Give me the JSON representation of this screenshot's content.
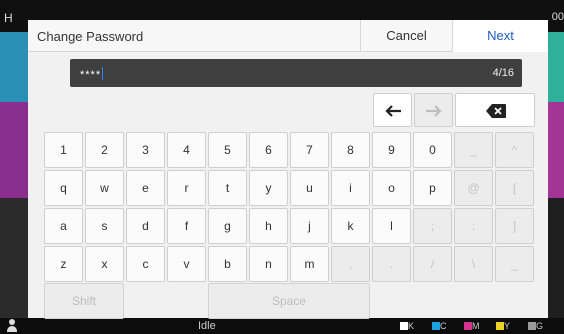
{
  "background": {
    "top_left_text": "H",
    "top_right_text": "00",
    "status": "Idle",
    "toner": [
      {
        "label": "K",
        "color": "#ffffff"
      },
      {
        "label": "C",
        "color": "#1aa3e0"
      },
      {
        "label": "M",
        "color": "#d6338f"
      },
      {
        "label": "Y",
        "color": "#f0d12a"
      },
      {
        "label": "G",
        "color": "#9a9a9a"
      }
    ],
    "tile_colors": [
      "#2a8fb5",
      "#2fb09a",
      "#8a2e8f",
      "#a23596",
      "#2b2b2b"
    ]
  },
  "dialog": {
    "title": "Change Password",
    "cancel_label": "Cancel",
    "next_label": "Next",
    "accent": "#1e5cc7"
  },
  "password": {
    "masked_value": "****",
    "count": "4/16"
  },
  "cursor_keys": {
    "left": {
      "icon": "arrow-left-icon",
      "enabled": true
    },
    "right": {
      "icon": "arrow-right-icon",
      "enabled": false
    },
    "backspace": {
      "icon": "backspace-icon",
      "enabled": true
    }
  },
  "keyboard": {
    "rows": [
      [
        {
          "label": "1",
          "enabled": true
        },
        {
          "label": "2",
          "enabled": true
        },
        {
          "label": "3",
          "enabled": true
        },
        {
          "label": "4",
          "enabled": true
        },
        {
          "label": "5",
          "enabled": true
        },
        {
          "label": "6",
          "enabled": true
        },
        {
          "label": "7",
          "enabled": true
        },
        {
          "label": "8",
          "enabled": true
        },
        {
          "label": "9",
          "enabled": true
        },
        {
          "label": "0",
          "enabled": true
        },
        {
          "label": "_",
          "enabled": false
        },
        {
          "label": "^",
          "enabled": false
        }
      ],
      [
        {
          "label": "q",
          "enabled": true
        },
        {
          "label": "w",
          "enabled": true
        },
        {
          "label": "e",
          "enabled": true
        },
        {
          "label": "r",
          "enabled": true
        },
        {
          "label": "t",
          "enabled": true
        },
        {
          "label": "y",
          "enabled": true
        },
        {
          "label": "u",
          "enabled": true
        },
        {
          "label": "i",
          "enabled": true
        },
        {
          "label": "o",
          "enabled": true
        },
        {
          "label": "p",
          "enabled": true
        },
        {
          "label": "@",
          "enabled": false
        },
        {
          "label": "[",
          "enabled": false
        }
      ],
      [
        {
          "label": "a",
          "enabled": true
        },
        {
          "label": "s",
          "enabled": true
        },
        {
          "label": "d",
          "enabled": true
        },
        {
          "label": "f",
          "enabled": true
        },
        {
          "label": "g",
          "enabled": true
        },
        {
          "label": "h",
          "enabled": true
        },
        {
          "label": "j",
          "enabled": true
        },
        {
          "label": "k",
          "enabled": true
        },
        {
          "label": "l",
          "enabled": true
        },
        {
          "label": ";",
          "enabled": false
        },
        {
          "label": ":",
          "enabled": false
        },
        {
          "label": "]",
          "enabled": false
        }
      ],
      [
        {
          "label": "z",
          "enabled": true
        },
        {
          "label": "x",
          "enabled": true
        },
        {
          "label": "c",
          "enabled": true
        },
        {
          "label": "v",
          "enabled": true
        },
        {
          "label": "b",
          "enabled": true
        },
        {
          "label": "n",
          "enabled": true
        },
        {
          "label": "m",
          "enabled": true
        },
        {
          "label": ",",
          "enabled": false
        },
        {
          "label": ".",
          "enabled": false
        },
        {
          "label": "/",
          "enabled": false
        },
        {
          "label": "\\",
          "enabled": false
        },
        {
          "label": "_",
          "enabled": false
        }
      ]
    ],
    "shift_label": "Shift",
    "space_label": "Space"
  }
}
